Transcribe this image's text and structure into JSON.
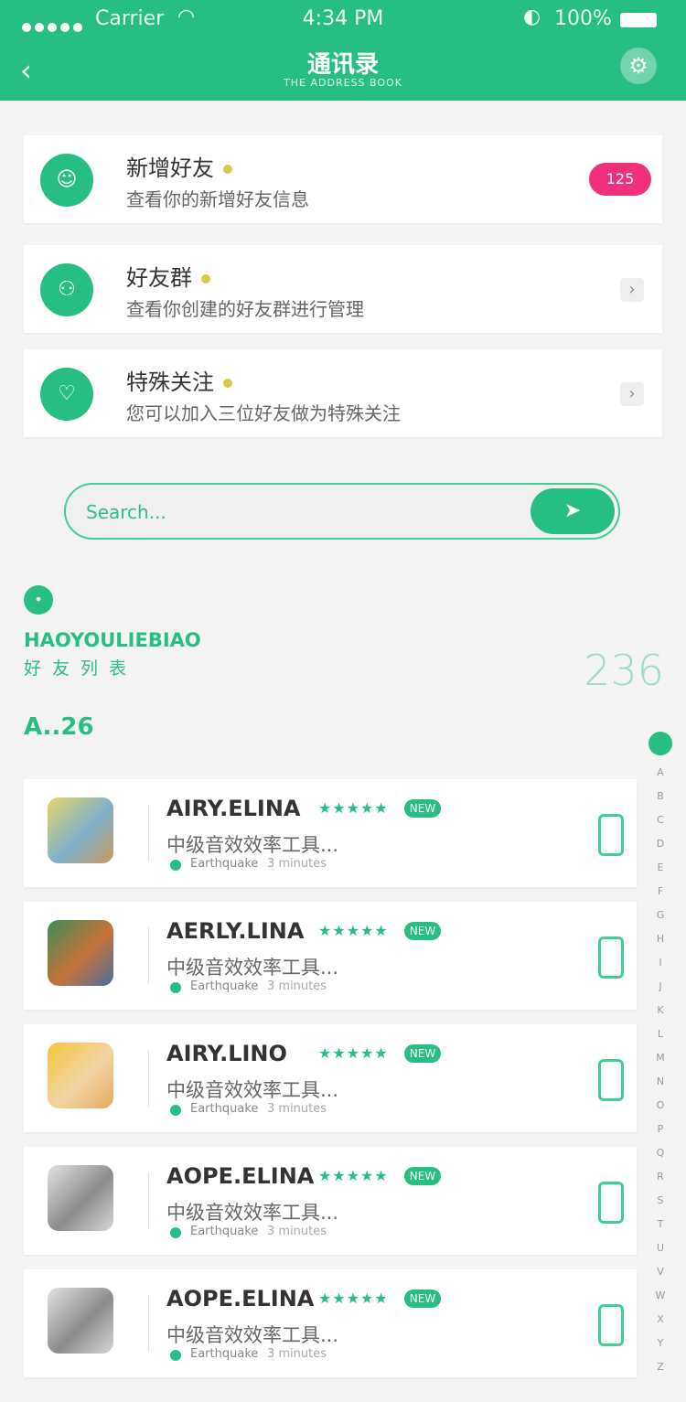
{
  "status_bar": {
    "carrier": "Carrier",
    "time": "4:34 PM",
    "battery": "100%"
  },
  "header": {
    "title": "通讯录",
    "subtitle": "THE ADDRESS BOOK"
  },
  "cards": [
    {
      "title": "新增好友",
      "desc": "查看你的新增好友信息",
      "badge": "125",
      "icon": "person-icon"
    },
    {
      "title": "好友群",
      "desc": "查看你创建的好友群进行管理",
      "icon": "group-icon"
    },
    {
      "title": "特殊关注",
      "desc": "您可以加入三位好友做为特殊关注",
      "icon": "heart-icon"
    }
  ],
  "search": {
    "placeholder": "Search..."
  },
  "brand": {
    "name": "HAOYOULIEBIAO",
    "subtitle": "好友列表",
    "count": "236"
  },
  "group_label": "A..26",
  "contacts": [
    {
      "name": "AIRY.ELINA",
      "desc": "中级音效效率工具...",
      "tag": "NEW",
      "meta1": "Earthquake",
      "meta2": "3 minutes"
    },
    {
      "name": "AERLY.LINA",
      "desc": "中级音效效率工具...",
      "tag": "NEW",
      "meta1": "Earthquake",
      "meta2": "3 minutes"
    },
    {
      "name": "AIRY.LINO",
      "desc": "中级音效效率工具...",
      "tag": "NEW",
      "meta1": "Earthquake",
      "meta2": "3 minutes"
    },
    {
      "name": "AOPE.ELINA",
      "desc": "中级音效效率工具...",
      "tag": "NEW",
      "meta1": "Earthquake",
      "meta2": "3 minutes"
    },
    {
      "name": "AOPE.ELINA",
      "desc": "中级音效效率工具...",
      "tag": "NEW",
      "meta1": "Earthquake",
      "meta2": "3 minutes"
    }
  ],
  "alphabet": [
    "A",
    "B",
    "C",
    "D",
    "E",
    "F",
    "G",
    "H",
    "I",
    "J",
    "K",
    "L",
    "M",
    "N",
    "O",
    "P",
    "Q",
    "R",
    "S",
    "T",
    "U",
    "V",
    "W",
    "X",
    "Y",
    "Z"
  ],
  "colors": {
    "accent": "#27be84",
    "badge": "#f0307d"
  }
}
